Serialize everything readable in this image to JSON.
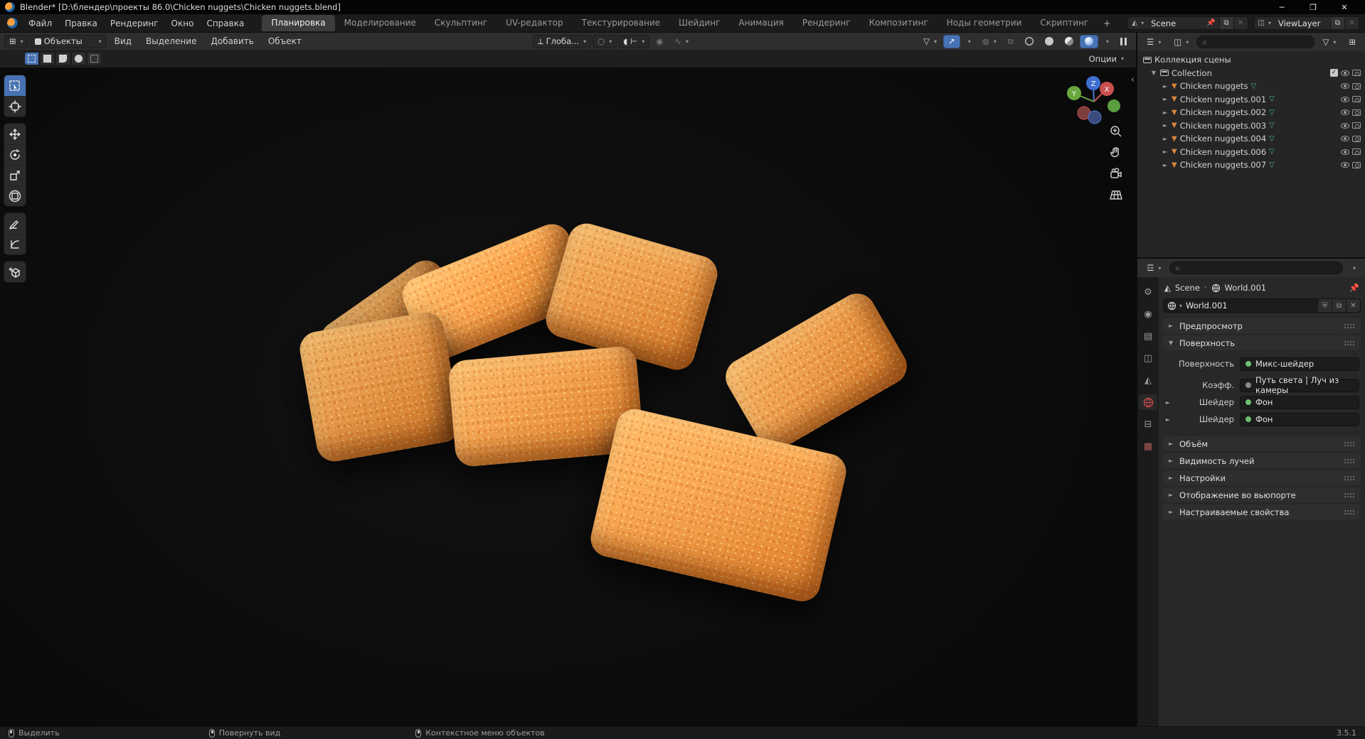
{
  "window": {
    "title": "Blender* [D:\\блендер\\проекты 86.0\\Chicken nuggets\\Chicken nuggets.blend]",
    "minimize": "─",
    "restore": "❐",
    "close": "✕"
  },
  "topbar": {
    "menus": [
      "Файл",
      "Правка",
      "Рендеринг",
      "Окно",
      "Справка"
    ],
    "tabs": [
      "Планировка",
      "Моделирование",
      "Скульптинг",
      "UV-редактор",
      "Текстурирование",
      "Шейдинг",
      "Анимация",
      "Рендеринг",
      "Композитинг",
      "Ноды геометрии",
      "Скриптинг"
    ],
    "active_tab": "Планировка",
    "add_tab": "+",
    "scene_name": "Scene",
    "view_layer_name": "ViewLayer"
  },
  "viewport_header": {
    "mode": "Объекты",
    "menus": [
      "Вид",
      "Выделение",
      "Добавить",
      "Объект"
    ],
    "orientation": "Глоба...",
    "options_label": "Опции"
  },
  "gizmo_axes": {
    "x": "X",
    "y": "Y",
    "z": "Z"
  },
  "outliner": {
    "scene_collection": "Коллекция сцены",
    "collection": "Collection",
    "items": [
      {
        "label": "Chicken nuggets"
      },
      {
        "label": "Chicken nuggets.001"
      },
      {
        "label": "Chicken nuggets.002"
      },
      {
        "label": "Chicken nuggets.003"
      },
      {
        "label": "Chicken nuggets.004"
      },
      {
        "label": "Chicken nuggets.006"
      },
      {
        "label": "Chicken nuggets.007"
      }
    ]
  },
  "properties": {
    "breadcrumb": {
      "scene": "Scene",
      "world": "World.001"
    },
    "name_field": "World.001",
    "panels": {
      "preview": "Предпросмотр",
      "surface": "Поверхность",
      "volume": "Объём",
      "ray_visibility": "Видимость лучей",
      "settings": "Настройки",
      "viewport_display": "Отображение во вьюпорте",
      "custom_props": "Настраиваемые свойства"
    },
    "surface_rows": [
      {
        "label": "Поверхность",
        "value": "Микс-шейдер",
        "dot": "green"
      },
      {
        "label": "Коэфф.",
        "value": "Путь света | Луч из камеры",
        "dot": "gray"
      },
      {
        "label": "Шейдер",
        "value": "Фон",
        "dot": "green"
      },
      {
        "label": "Шейдер",
        "value": "Фон",
        "dot": "green"
      }
    ]
  },
  "statusbar": {
    "hints": [
      {
        "label": "Выделить"
      },
      {
        "label": "Повернуть вид"
      },
      {
        "label": "Контекстное меню объектов"
      }
    ],
    "version": "3.5.1"
  },
  "colors": {
    "accent_blue": "#4772b3",
    "nugget_orange": "#eda04e",
    "mesh_icon_orange": "#d9853c",
    "data_icon_green": "#45b488",
    "world_icon_red": "#c84b4b"
  }
}
